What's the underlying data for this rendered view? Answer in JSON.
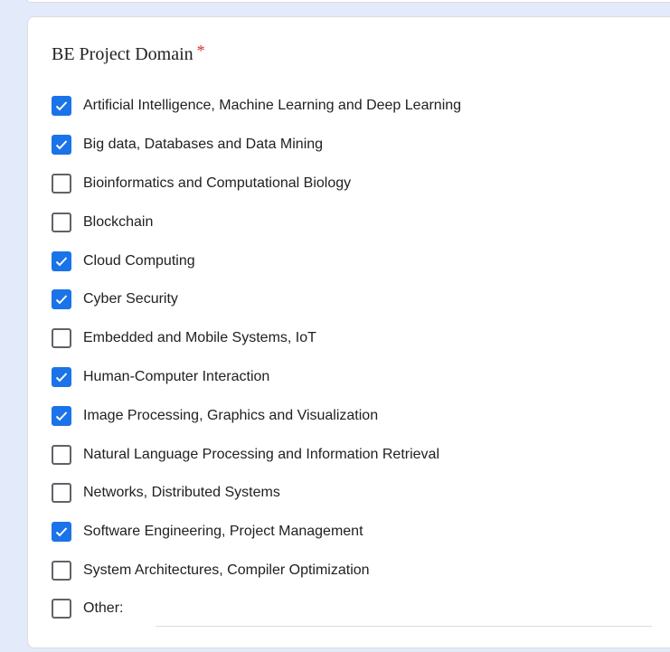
{
  "question": {
    "title": "BE Project Domain",
    "required_mark": "*",
    "options": [
      {
        "label": "Artificial Intelligence, Machine Learning and Deep Learning",
        "checked": true
      },
      {
        "label": "Big data, Databases and Data Mining",
        "checked": true
      },
      {
        "label": "Bioinformatics and Computational Biology",
        "checked": false
      },
      {
        "label": "Blockchain",
        "checked": false
      },
      {
        "label": "Cloud Computing",
        "checked": true
      },
      {
        "label": "Cyber Security",
        "checked": true
      },
      {
        "label": "Embedded and Mobile Systems, IoT",
        "checked": false
      },
      {
        "label": "Human-Computer Interaction",
        "checked": true
      },
      {
        "label": "Image Processing, Graphics and Visualization",
        "checked": true
      },
      {
        "label": "Natural Language Processing and Information Retrieval",
        "checked": false
      },
      {
        "label": "Networks, Distributed Systems",
        "checked": false
      },
      {
        "label": "Software Engineering, Project Management",
        "checked": true
      },
      {
        "label": "System Architectures, Compiler Optimization",
        "checked": false
      }
    ],
    "other": {
      "label": "Other:",
      "checked": false,
      "value": ""
    }
  },
  "colors": {
    "accent": "#1a73e8",
    "background": "#e3ebfa",
    "required": "#d93025"
  }
}
